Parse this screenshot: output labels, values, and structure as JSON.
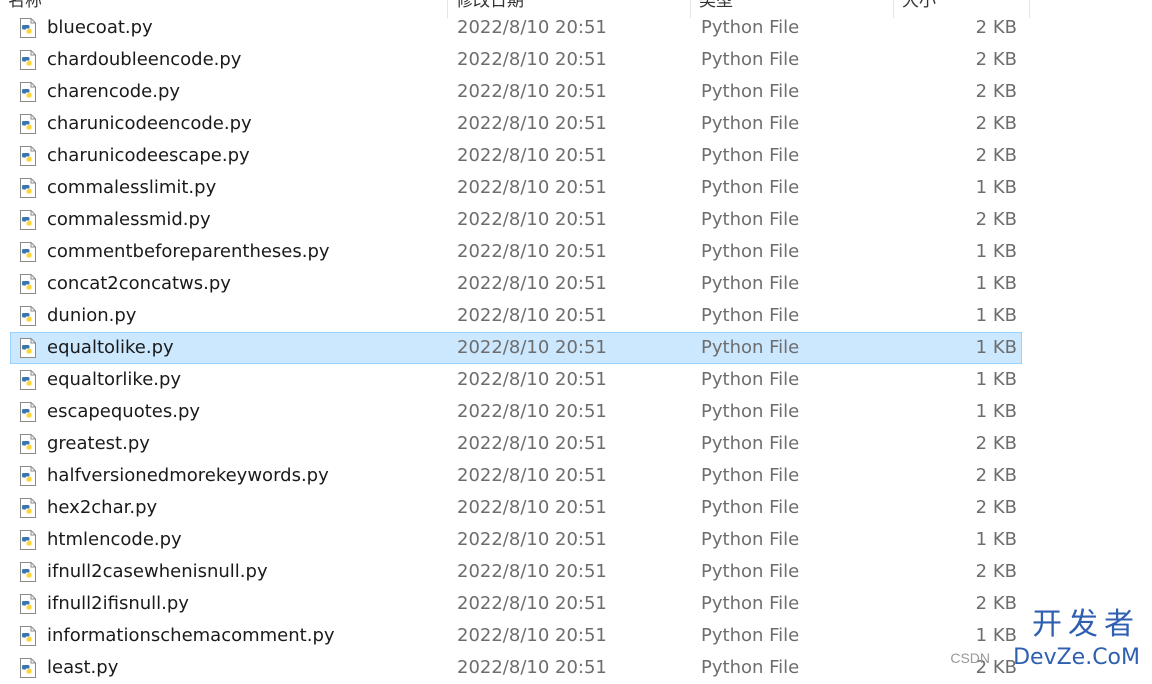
{
  "columns": {
    "name": "名称",
    "date": "修改日期",
    "type": "类型",
    "size": "大小"
  },
  "files": [
    {
      "name": "bluecoat.py",
      "date": "2022/8/10 20:51",
      "type": "Python File",
      "size": "2 KB"
    },
    {
      "name": "chardoubleencode.py",
      "date": "2022/8/10 20:51",
      "type": "Python File",
      "size": "2 KB"
    },
    {
      "name": "charencode.py",
      "date": "2022/8/10 20:51",
      "type": "Python File",
      "size": "2 KB"
    },
    {
      "name": "charunicodeencode.py",
      "date": "2022/8/10 20:51",
      "type": "Python File",
      "size": "2 KB"
    },
    {
      "name": "charunicodeescape.py",
      "date": "2022/8/10 20:51",
      "type": "Python File",
      "size": "2 KB"
    },
    {
      "name": "commalesslimit.py",
      "date": "2022/8/10 20:51",
      "type": "Python File",
      "size": "1 KB"
    },
    {
      "name": "commalessmid.py",
      "date": "2022/8/10 20:51",
      "type": "Python File",
      "size": "2 KB"
    },
    {
      "name": "commentbeforeparentheses.py",
      "date": "2022/8/10 20:51",
      "type": "Python File",
      "size": "1 KB"
    },
    {
      "name": "concat2concatws.py",
      "date": "2022/8/10 20:51",
      "type": "Python File",
      "size": "1 KB"
    },
    {
      "name": "dunion.py",
      "date": "2022/8/10 20:51",
      "type": "Python File",
      "size": "1 KB"
    },
    {
      "name": "equaltolike.py",
      "date": "2022/8/10 20:51",
      "type": "Python File",
      "size": "1 KB",
      "selected": true
    },
    {
      "name": "equaltorlike.py",
      "date": "2022/8/10 20:51",
      "type": "Python File",
      "size": "1 KB"
    },
    {
      "name": "escapequotes.py",
      "date": "2022/8/10 20:51",
      "type": "Python File",
      "size": "1 KB"
    },
    {
      "name": "greatest.py",
      "date": "2022/8/10 20:51",
      "type": "Python File",
      "size": "2 KB"
    },
    {
      "name": "halfversionedmorekeywords.py",
      "date": "2022/8/10 20:51",
      "type": "Python File",
      "size": "2 KB"
    },
    {
      "name": "hex2char.py",
      "date": "2022/8/10 20:51",
      "type": "Python File",
      "size": "2 KB"
    },
    {
      "name": "htmlencode.py",
      "date": "2022/8/10 20:51",
      "type": "Python File",
      "size": "1 KB"
    },
    {
      "name": "ifnull2casewhenisnull.py",
      "date": "2022/8/10 20:51",
      "type": "Python File",
      "size": "2 KB"
    },
    {
      "name": "ifnull2ifisnull.py",
      "date": "2022/8/10 20:51",
      "type": "Python File",
      "size": "2 KB"
    },
    {
      "name": "informationschemacomment.py",
      "date": "2022/8/10 20:51",
      "type": "Python File",
      "size": "1 KB"
    },
    {
      "name": "least.py",
      "date": "2022/8/10 20:51",
      "type": "Python File",
      "size": "2 KB"
    }
  ],
  "watermark": {
    "big": "开发者",
    "sub": "DevZe.CoM",
    "csdn": "CSDN"
  },
  "colors": {
    "selection_bg": "#cce8ff",
    "selection_border": "#99d1ff",
    "python_blue": "#3776ab",
    "python_yellow": "#ffd43b"
  },
  "icons": {
    "file": "python-file-icon"
  }
}
